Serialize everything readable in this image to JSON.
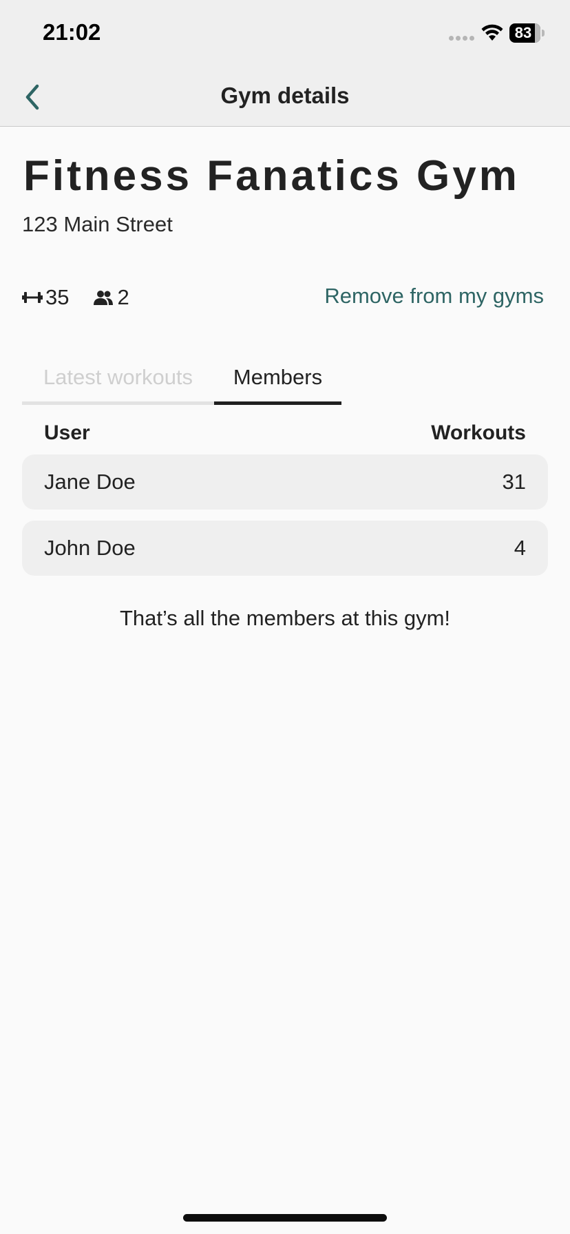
{
  "status_bar": {
    "time": "21:02",
    "battery_level": "83",
    "icons": [
      "signal-dots-icon",
      "wifi-icon",
      "battery-icon"
    ]
  },
  "nav": {
    "title": "Gym details",
    "back_icon": "chevron-left-icon"
  },
  "gym": {
    "name": "Fitness Fanatics Gym",
    "address": "123 Main Street",
    "workouts_count": "35",
    "members_count": "2",
    "remove_label": "Remove from my gyms"
  },
  "tabs": [
    {
      "label": "Latest workouts",
      "active": false
    },
    {
      "label": "Members",
      "active": true
    }
  ],
  "table": {
    "headers": {
      "user": "User",
      "workouts": "Workouts"
    },
    "rows": [
      {
        "name": "Jane Doe",
        "workouts": "31"
      },
      {
        "name": "John Doe",
        "workouts": "4"
      }
    ]
  },
  "footer_note": "That’s all the members at this gym!",
  "colors": {
    "accent": "#2e6564",
    "background": "#fafafa",
    "bar_background": "#efefef",
    "text": "#222222"
  }
}
